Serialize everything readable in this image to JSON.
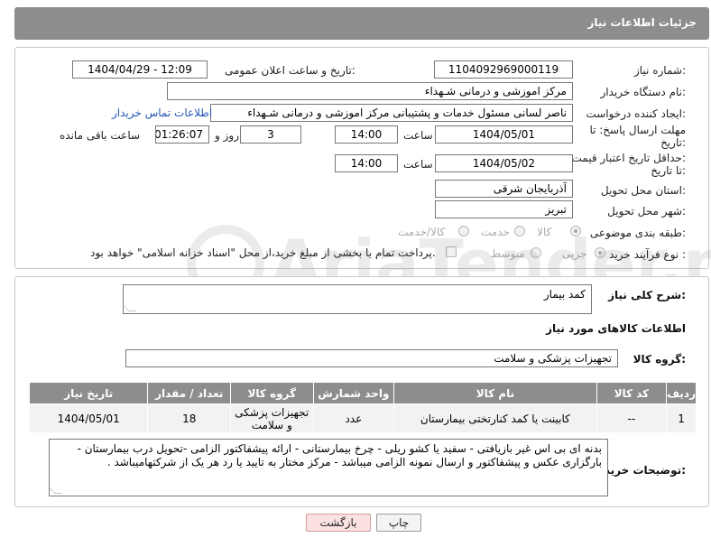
{
  "header": {
    "title": "جزئیات اطلاعات نیاز"
  },
  "form": {
    "need_number_label": "شماره نیاز:",
    "need_number": "1104092969000119",
    "announce_label": "تاریخ و ساعت اعلان عمومی:",
    "announce_value": "1404/04/29 - 12:09",
    "buyer_org_label": "نام دستگاه خریدار:",
    "buyer_org": "مرکز اموزشی و درمانی شـهداء",
    "creator_label": "ایجاد کننده درخواست:",
    "creator": "ناصر لسانی مسئول خدمات و پشتیبانی مرکز اموزشی و درمانی شـهداء",
    "contact_link": "اطلاعات تماس خریدار",
    "deadline_label_1": "مهلت ارسال پاسخ: تا",
    "deadline_label_2": "تاریخ:",
    "deadline_date": "1404/05/01",
    "time_label": "ساعت",
    "deadline_time": "14:00",
    "days_value": "3",
    "days_label": "روز و",
    "remaining_time": "01:26:07",
    "remaining_label": "ساعت باقی مانده",
    "min_validity_label_1": "حداقل تاریخ اعتبار قیمت:",
    "min_validity_label_2": "تا تاریخ:",
    "validity_date": "1404/05/02",
    "validity_time": "14:00",
    "province_label": "استان محل تحویل:",
    "province": "آذربایجان شرقی",
    "city_label": "شهر محل تحویل:",
    "city": "تبریز",
    "category_label": "طبقه بندی موضوعی:",
    "category_options": [
      "کالا",
      "خدمت",
      "کالا/خدمت"
    ],
    "process_label": "نوع فرآیند خرید :",
    "process_options": [
      "جزیی",
      "متوسط"
    ],
    "payment_note": "پرداخت تمام یا بخشی از مبلغ خرید،از محل \"اسناد خزانه اسلامی\" خواهد بود."
  },
  "description": {
    "label": "شرح کلی نیاز:",
    "value": "کمد بیمار"
  },
  "goods": {
    "section_title": "اطلاعات کالاهای مورد نیاز",
    "group_label": "گروه کالا:",
    "group_value": "تجهیزات پزشکی و سلامت",
    "table": {
      "headers": [
        "ردیف",
        "کد کالا",
        "نام کالا",
        "واحد شمارش",
        "گروه کالا",
        "تعداد / مقدار",
        "تاریخ نیاز"
      ],
      "rows": [
        [
          "1",
          "--",
          "کابینت یا کمد کنارتختی بیمارستان",
          "عدد",
          "تجهیزات پزشکی و سلامت",
          "18",
          "1404/05/01"
        ]
      ]
    }
  },
  "buyer_notes": {
    "label": "توضیحات خریدار:",
    "value": "بدنه ای بی اس غیر بازیافتی - سفید یا کشو ریلی - چرخ بیمارستانی  - ارائه پیشفاکتور الزامی -تحویل درب بیمارستان - بارگزاری عکس و پیشفاکتور و ارسال نمونه الزامی میباشد - مرکز مختار به تایید یا رد هر یک  از شرکتهامیباشد    ."
  },
  "buttons": {
    "print": "چاپ",
    "back": "بازگشت"
  },
  "watermark": {
    "text": "AriaTender.net"
  }
}
